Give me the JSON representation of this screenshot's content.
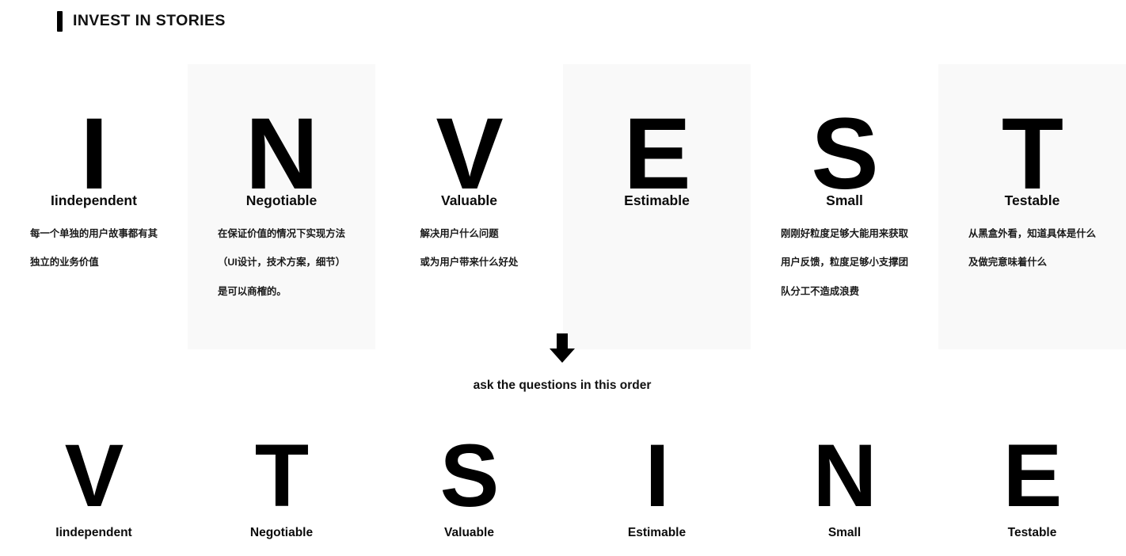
{
  "header": {
    "accent_color": "#000000",
    "title": "INVEST IN STORIES"
  },
  "cards": [
    {
      "letter": "I",
      "label": "Iindependent",
      "shaded": false,
      "desc_lines": [
        "每一个单独的用户故事都有其",
        "独立的业务价值"
      ]
    },
    {
      "letter": "N",
      "label": "Negotiable",
      "shaded": true,
      "desc_lines": [
        "在保证价值的情况下实现方法",
        "（UI设计，技术方案，细节）",
        "是可以商榷的。"
      ]
    },
    {
      "letter": "V",
      "label": "Valuable",
      "shaded": false,
      "desc_lines": [
        "解决用户什么问题",
        "或为用户带来什么好处"
      ]
    },
    {
      "letter": "E",
      "label": "Estimable",
      "shaded": true,
      "desc_lines": []
    },
    {
      "letter": "S",
      "label": "Small",
      "shaded": false,
      "desc_lines": [
        "刚刚好粒度足够大能用来获取",
        "用户反馈，粒度足够小支撑团",
        "队分工不造成浪费"
      ]
    },
    {
      "letter": "T",
      "label": "Testable",
      "shaded": true,
      "desc_lines": [
        "从黑盒外看，知道具体是什么",
        "及做完意味着什么"
      ]
    }
  ],
  "flow": {
    "arrow_icon": "arrow-down-icon",
    "caption": "ask the questions in this order"
  },
  "order_row": [
    {
      "letter": "V",
      "label": "Iindependent"
    },
    {
      "letter": "T",
      "label": "Negotiable"
    },
    {
      "letter": "S",
      "label": "Valuable"
    },
    {
      "letter": "I",
      "label": "Estimable"
    },
    {
      "letter": "N",
      "label": "Small"
    },
    {
      "letter": "E",
      "label": "Testable"
    }
  ]
}
